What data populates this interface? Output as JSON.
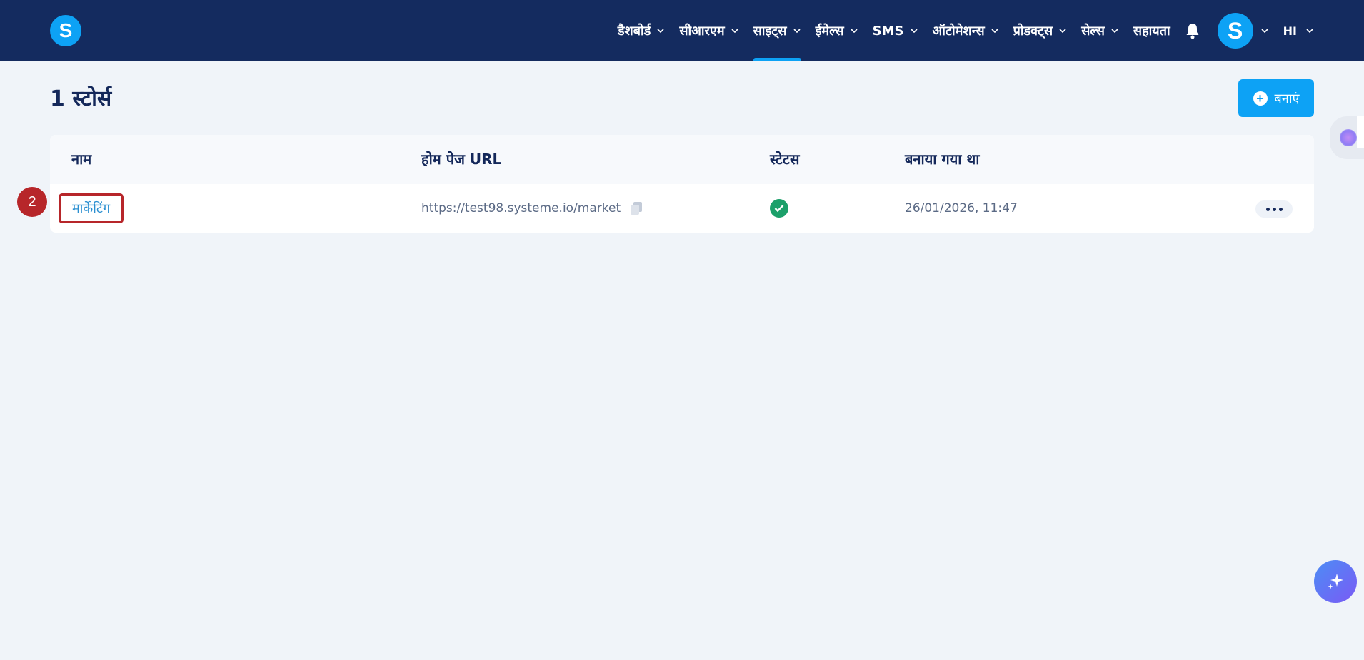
{
  "app": {
    "logo_letter": "S",
    "avatar_letter": "S",
    "language": "HI"
  },
  "nav": {
    "items": [
      {
        "label": "डैशबोर्ड",
        "has_menu": true
      },
      {
        "label": "सीआरएम",
        "has_menu": true
      },
      {
        "label": "साइट्स",
        "has_menu": true,
        "active": true
      },
      {
        "label": "ईमेल्स",
        "has_menu": true
      },
      {
        "label": "SMS",
        "has_menu": true
      },
      {
        "label": "ऑटोमेशन्स",
        "has_menu": true
      },
      {
        "label": "प्रोडक्ट्स",
        "has_menu": true
      },
      {
        "label": "सेल्स",
        "has_menu": true
      },
      {
        "label": "सहायता",
        "has_menu": false
      }
    ]
  },
  "page": {
    "title": "1 स्टोर्स",
    "create_label": "बनाएं"
  },
  "table": {
    "columns": [
      "नाम",
      "होम पेज URL",
      "स्टेटस",
      "बनाया गया था"
    ],
    "rows": [
      {
        "name": "मार्केटिंग",
        "url": "https://test98.systeme.io/market",
        "status": "active",
        "created": "26/01/2026, 11:47"
      }
    ]
  },
  "annotation": {
    "step": "2"
  },
  "colors": {
    "nav_bg": "#142b5f",
    "accent": "#0da2f5",
    "highlight": "#b7262a",
    "status_ok": "#1ca06a"
  },
  "icons": [
    "bell-icon",
    "copy-icon",
    "check-icon",
    "more-icon",
    "sparkle-icon",
    "plus-icon",
    "chevron-down-icon"
  ]
}
